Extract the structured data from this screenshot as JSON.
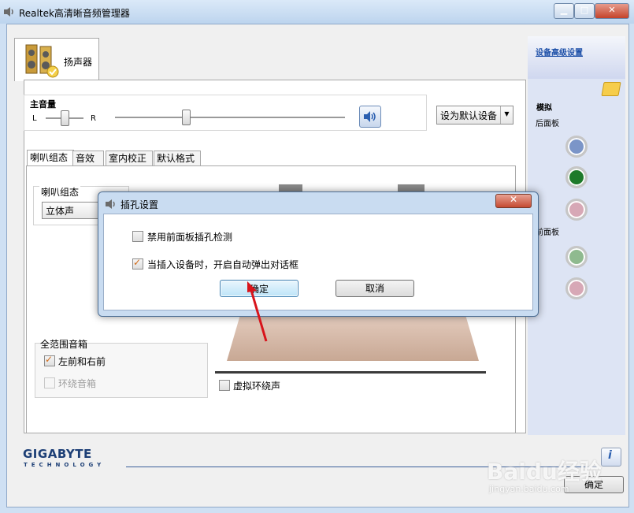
{
  "window": {
    "title": "Realtek高清晰音频管理器"
  },
  "device_tab": {
    "label": "扬声器"
  },
  "right_panel": {
    "advanced_link": "设备高级设置",
    "analog_label": "模拟",
    "rear_panel_label": "后面板",
    "front_panel_label": "前面板",
    "rear_jacks": [
      "#7b95c8",
      "#1d7a2a",
      "#d7a8b6"
    ],
    "front_jacks": [
      "#8fba8f",
      "#d7a8b6"
    ]
  },
  "volume": {
    "label": "主音量",
    "left": "L",
    "right": "R",
    "default_device": "设为默认设备"
  },
  "tabs": [
    "喇叭组态",
    "音效",
    "室内校正",
    "默认格式"
  ],
  "speaker_config": {
    "label": "喇叭组态",
    "selected": "立体声"
  },
  "full_range": {
    "label": "全范围音箱",
    "front_lr": "左前和右前",
    "surround": "环绕音箱",
    "front_lr_checked": true,
    "surround_checked": false,
    "surround_disabled": true
  },
  "virtual_surround": {
    "label": "虚拟环绕声",
    "checked": false
  },
  "brand": {
    "name": "GIGABYTE",
    "sub": "TECHNOLOGY"
  },
  "bottom_ok": "确定",
  "dialog": {
    "title": "插孔设置",
    "option1": "禁用前面板插孔检测",
    "option1_checked": false,
    "option2": "当插入设备时，开启自动弹出对话框",
    "option2_checked": true,
    "ok": "确定",
    "cancel": "取消",
    "close": "✕"
  },
  "watermark": {
    "text": "Baidu经验",
    "url": "jingyan.baidu.com"
  },
  "colors": {
    "accent": "#1c4fa8",
    "annotation_arrow": "#d8141b",
    "brand": "#1d3f76"
  }
}
